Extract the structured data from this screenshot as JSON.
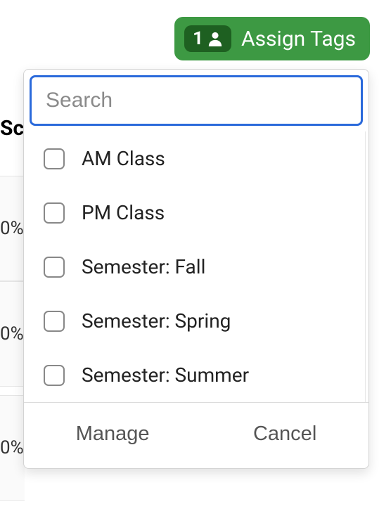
{
  "header": {
    "assign_button_label": "Assign Tags",
    "selected_count": "1"
  },
  "search": {
    "placeholder": "Search"
  },
  "tags": [
    {
      "label": "AM Class"
    },
    {
      "label": "PM Class"
    },
    {
      "label": "Semester: Fall"
    },
    {
      "label": "Semester: Spring"
    },
    {
      "label": "Semester: Summer"
    }
  ],
  "footer": {
    "manage_label": "Manage",
    "cancel_label": "Cancel"
  },
  "background": {
    "partial_heading": "Sc",
    "pct_1": "0%",
    "pct_2": "0%",
    "pct_3": "0%"
  }
}
